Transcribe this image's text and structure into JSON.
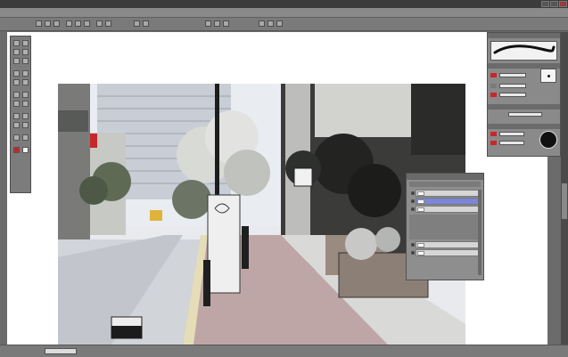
{
  "app": {
    "title": ""
  },
  "menu": {
    "items": []
  },
  "zoom_label": "",
  "colors": {
    "accent_red": "#c6272b",
    "selected_layer": "#7b87d8",
    "panel_bg": "#8a8a8a",
    "workspace_bg": "#ffffff"
  },
  "toolbar": {
    "button_count": 16
  },
  "tools": {
    "count": 22
  },
  "right_panel": {
    "sections": [
      "brush-preview",
      "brush-size",
      "color",
      "opacity"
    ]
  },
  "layers": {
    "rows": [
      {
        "name": "",
        "selected": false
      },
      {
        "name": "",
        "selected": true
      },
      {
        "name": "",
        "selected": false
      },
      {
        "name": "",
        "selected": false
      },
      {
        "name": "",
        "selected": false
      }
    ]
  },
  "icons": [
    "eye-icon",
    "layer-thumbnail-icon",
    "brush-stroke-icon",
    "brush-dot-icon",
    "minimize-icon",
    "maximize-icon",
    "close-icon"
  ]
}
